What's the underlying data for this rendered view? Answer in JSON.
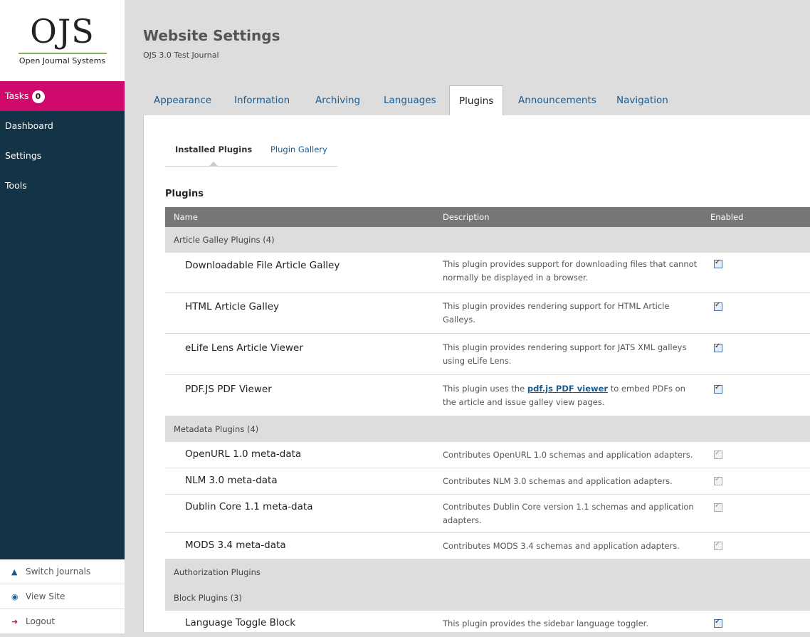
{
  "logo": {
    "mark": "OJS",
    "subtitle": "Open Journal Systems"
  },
  "nav": {
    "tasks_label": "Tasks",
    "tasks_count": "0",
    "items": [
      "Dashboard",
      "Settings",
      "Tools"
    ]
  },
  "util": {
    "switch": "Switch Journals",
    "view": "View Site",
    "logout": "Logout"
  },
  "header": {
    "title": "Website Settings",
    "subtitle": "OJS 3.0 Test Journal"
  },
  "tabs": [
    "Appearance",
    "Information",
    "Archiving",
    "Languages",
    "Plugins",
    "Announcements",
    "Navigation"
  ],
  "subtabs": {
    "installed": "Installed Plugins",
    "gallery": "Plugin Gallery"
  },
  "section_title": "Plugins",
  "table": {
    "headers": {
      "name": "Name",
      "description": "Description",
      "enabled": "Enabled"
    },
    "groups": {
      "article_galley": "Article Galley Plugins (4)",
      "metadata": "Metadata Plugins (4)",
      "authorization": "Authorization Plugins",
      "block": "Block Plugins (3)"
    },
    "rows": [
      {
        "name": "Downloadable File Article Galley",
        "desc": "This plugin provides support for downloading files that cannot normally be displayed in a browser."
      },
      {
        "name": "HTML Article Galley",
        "desc": "This plugin provides rendering support for HTML Article Galleys."
      },
      {
        "name": "eLife Lens Article Viewer",
        "desc": "This plugin provides rendering support for JATS XML galleys using eLife Lens."
      },
      {
        "name": "PDF.JS PDF Viewer",
        "desc_pre": "This plugin uses the ",
        "desc_link": "pdf.js PDF viewer",
        "desc_post": " to embed PDFs on the article and issue galley view pages."
      },
      {
        "name": "OpenURL 1.0 meta-data",
        "desc": "Contributes OpenURL 1.0 schemas and application adapters."
      },
      {
        "name": "NLM 3.0 meta-data",
        "desc": "Contributes NLM 3.0 schemas and application adapters."
      },
      {
        "name": "Dublin Core 1.1 meta-data",
        "desc": "Contributes Dublin Core version 1.1 schemas and application adapters."
      },
      {
        "name": "MODS 3.4 meta-data",
        "desc": "Contributes MODS 3.4 schemas and application adapters."
      },
      {
        "name": "Language Toggle Block",
        "desc": "This plugin provides the sidebar language toggler."
      }
    ]
  }
}
